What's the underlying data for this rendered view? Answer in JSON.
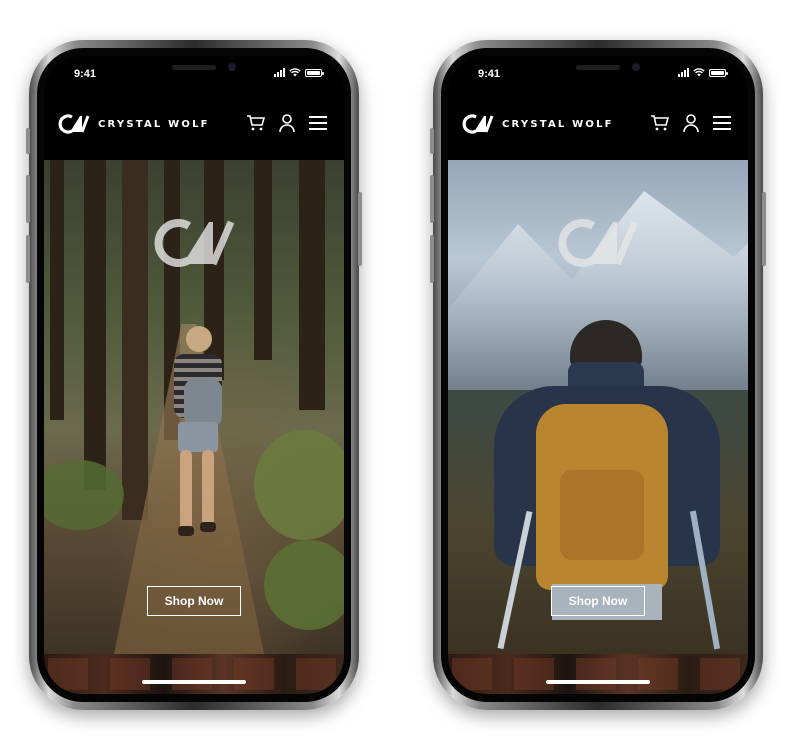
{
  "phones": [
    {
      "status": {
        "time": "9:41"
      },
      "brand": {
        "name": "CRYSTAL WOLF"
      },
      "hero": {
        "cta_label": "Shop Now"
      }
    },
    {
      "status": {
        "time": "9:41"
      },
      "brand": {
        "name": "CRYSTAL WOLF"
      },
      "hero": {
        "cta_label": "Shop Now"
      }
    }
  ],
  "colors": {
    "navbar": "#000000",
    "text": "#ffffff",
    "frame": "#2b2b2b"
  },
  "icons": [
    "cw-logo-icon",
    "cart-icon",
    "user-icon",
    "menu-icon",
    "signal-icon",
    "wifi-icon",
    "battery-icon"
  ]
}
